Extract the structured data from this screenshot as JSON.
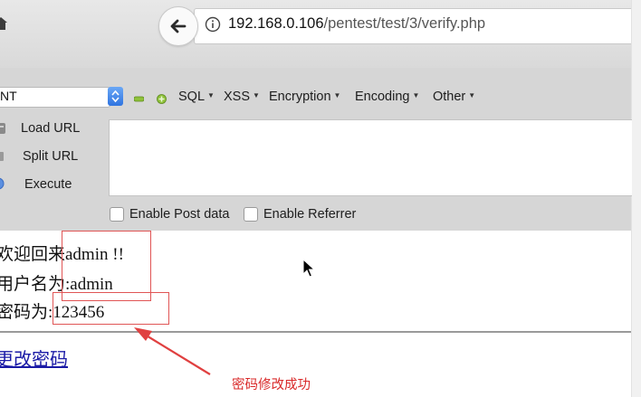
{
  "browser": {
    "url_host": "192.168.0.106",
    "url_path": "/pentest/test/3/verify.php"
  },
  "hackbar": {
    "select_value": "NT",
    "menus": [
      "SQL",
      "XSS",
      "Encryption",
      "Encoding",
      "Other"
    ],
    "load_url": "Load URL",
    "split_url": "Split URL",
    "execute": "Execute",
    "textarea_value": "",
    "enable_post": "Enable Post data",
    "enable_referrer": "Enable Referrer"
  },
  "page": {
    "welcome": "欢迎回来admin !!",
    "username_line": "用户名为:admin",
    "password_line": "密码为:123456",
    "change_password_link": "更改密码"
  },
  "annotation": {
    "text": "密码修改成功",
    "color": "#d92a2a"
  },
  "colors": {
    "link": "#1a1aa6",
    "toolbar_bg": "#d6d6d6",
    "highlight_box": "#e05555"
  },
  "icons": [
    "home-icon",
    "back-arrow-icon",
    "info-icon",
    "mouse-cursor-icon",
    "select-arrows-icon",
    "minus-icon",
    "plus-icon"
  ]
}
